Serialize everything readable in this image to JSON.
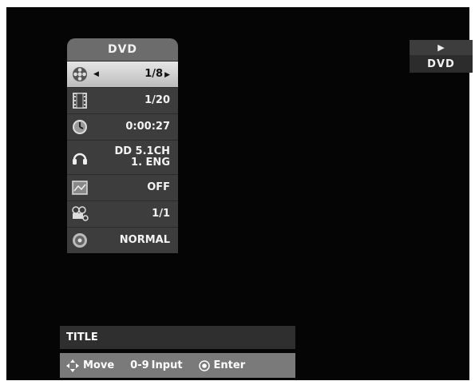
{
  "status": {
    "play_icon": "play-icon",
    "disc_label": "DVD"
  },
  "osd": {
    "header": "DVD",
    "rows": [
      {
        "icon": "title-reel-icon",
        "value": "1/8",
        "selected": true
      },
      {
        "icon": "chapter-film-icon",
        "value": "1/20"
      },
      {
        "icon": "clock-icon",
        "value": "0:00:27"
      },
      {
        "icon": "headphones-icon",
        "value_line1": "DD 5.1CH",
        "value_line2": "1. ENG"
      },
      {
        "icon": "subtitle-icon",
        "value": "OFF"
      },
      {
        "icon": "camera-angle-icon",
        "value": "1/1"
      },
      {
        "icon": "speaker-icon",
        "value": "NORMAL"
      }
    ]
  },
  "footer": {
    "title": "TITLE",
    "help": {
      "move_label": "Move",
      "input_key": "0-9",
      "input_label": "Input",
      "enter_label": "Enter"
    }
  }
}
